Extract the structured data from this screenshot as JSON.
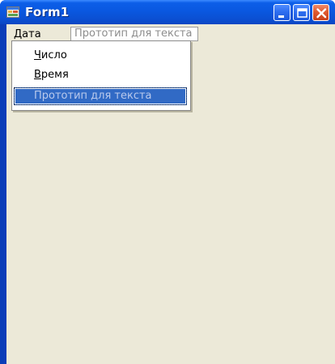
{
  "window": {
    "title": "Form1",
    "icon": "form-app-icon",
    "controls": [
      "minimize-icon",
      "maximize-icon",
      "close-icon"
    ]
  },
  "menubar": {
    "items": [
      {
        "label_mnemonic": "Д",
        "label_rest": "ата",
        "label": "Дата"
      }
    ],
    "textbox_placeholder": "Прототип для текста"
  },
  "dropdown": {
    "items": [
      {
        "label_mnemonic": "Ч",
        "label_rest": "исло",
        "label": "Число"
      },
      {
        "label_mnemonic": "В",
        "label_rest": "ремя",
        "label": "Время"
      }
    ],
    "textbox_placeholder": "Прототип для текста"
  },
  "colors": {
    "titlebar": "#0a58e0",
    "client_background": "#ece9d8",
    "selection": "#316ac5",
    "close_button": "#e05a30"
  }
}
